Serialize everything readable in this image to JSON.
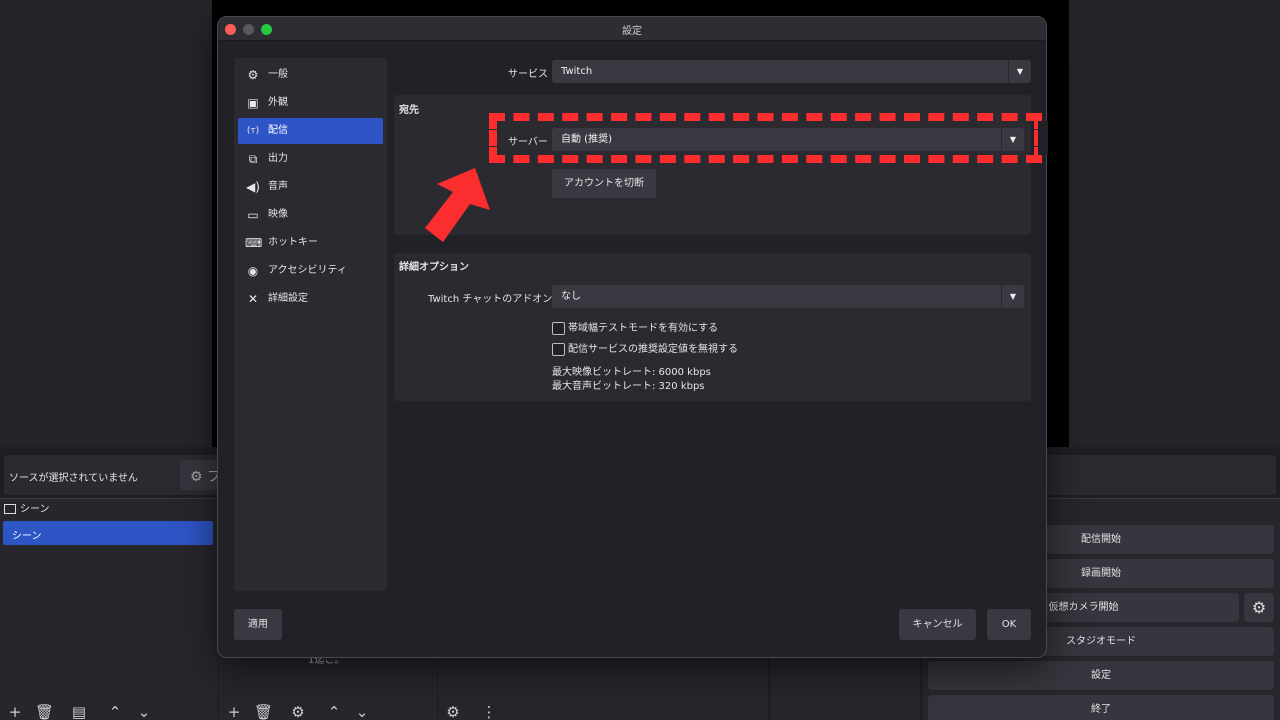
{
  "main": {
    "no_source_text": "ソースが選択されていません",
    "props_button_label": "プ",
    "scenes_dock": {
      "title": "シーン",
      "items": [
        "シーン"
      ]
    },
    "sources_dock_partial_text": "1迄こ。",
    "controls": {
      "start_stream": "配信開始",
      "start_record": "録画開始",
      "start_virtual_cam": "仮想カメラ開始",
      "studio_mode": "スタジオモード",
      "settings": "設定",
      "exit": "終了"
    }
  },
  "dialog": {
    "title": "設定",
    "nav": [
      {
        "label": "一般",
        "icon": "gear-icon",
        "active": false
      },
      {
        "label": "外観",
        "icon": "appearance-icon",
        "active": false
      },
      {
        "label": "配信",
        "icon": "stream-icon",
        "active": true
      },
      {
        "label": "出力",
        "icon": "output-icon",
        "active": false
      },
      {
        "label": "音声",
        "icon": "speaker-icon",
        "active": false
      },
      {
        "label": "映像",
        "icon": "monitor-icon",
        "active": false
      },
      {
        "label": "ホットキー",
        "icon": "keyboard-icon",
        "active": false
      },
      {
        "label": "アクセシビリティ",
        "icon": "accessibility-icon",
        "active": false
      },
      {
        "label": "詳細設定",
        "icon": "wrench-icon",
        "active": false
      }
    ],
    "service": {
      "label": "サービス",
      "value": "Twitch"
    },
    "destination": {
      "title": "宛先",
      "server_label": "サーバー",
      "server_value": "自動 (推奨)",
      "disconnect_button": "アカウントを切断"
    },
    "advanced": {
      "title": "詳細オプション",
      "addon_label": "Twitch チャットのアドオン",
      "addon_value": "なし",
      "bandwidth_test": "帯域幅テストモードを有効にする",
      "ignore_recommended": "配信サービスの推奨設定値を無視する",
      "max_video_bitrate": "最大映像ビットレート: 6000 kbps",
      "max_audio_bitrate": "最大音声ビットレート: 320 kbps"
    },
    "apply_button": "適用",
    "cancel_button": "キャンセル",
    "ok_button": "OK"
  },
  "annotation": {
    "highlight_color": "#fb2d2f"
  }
}
